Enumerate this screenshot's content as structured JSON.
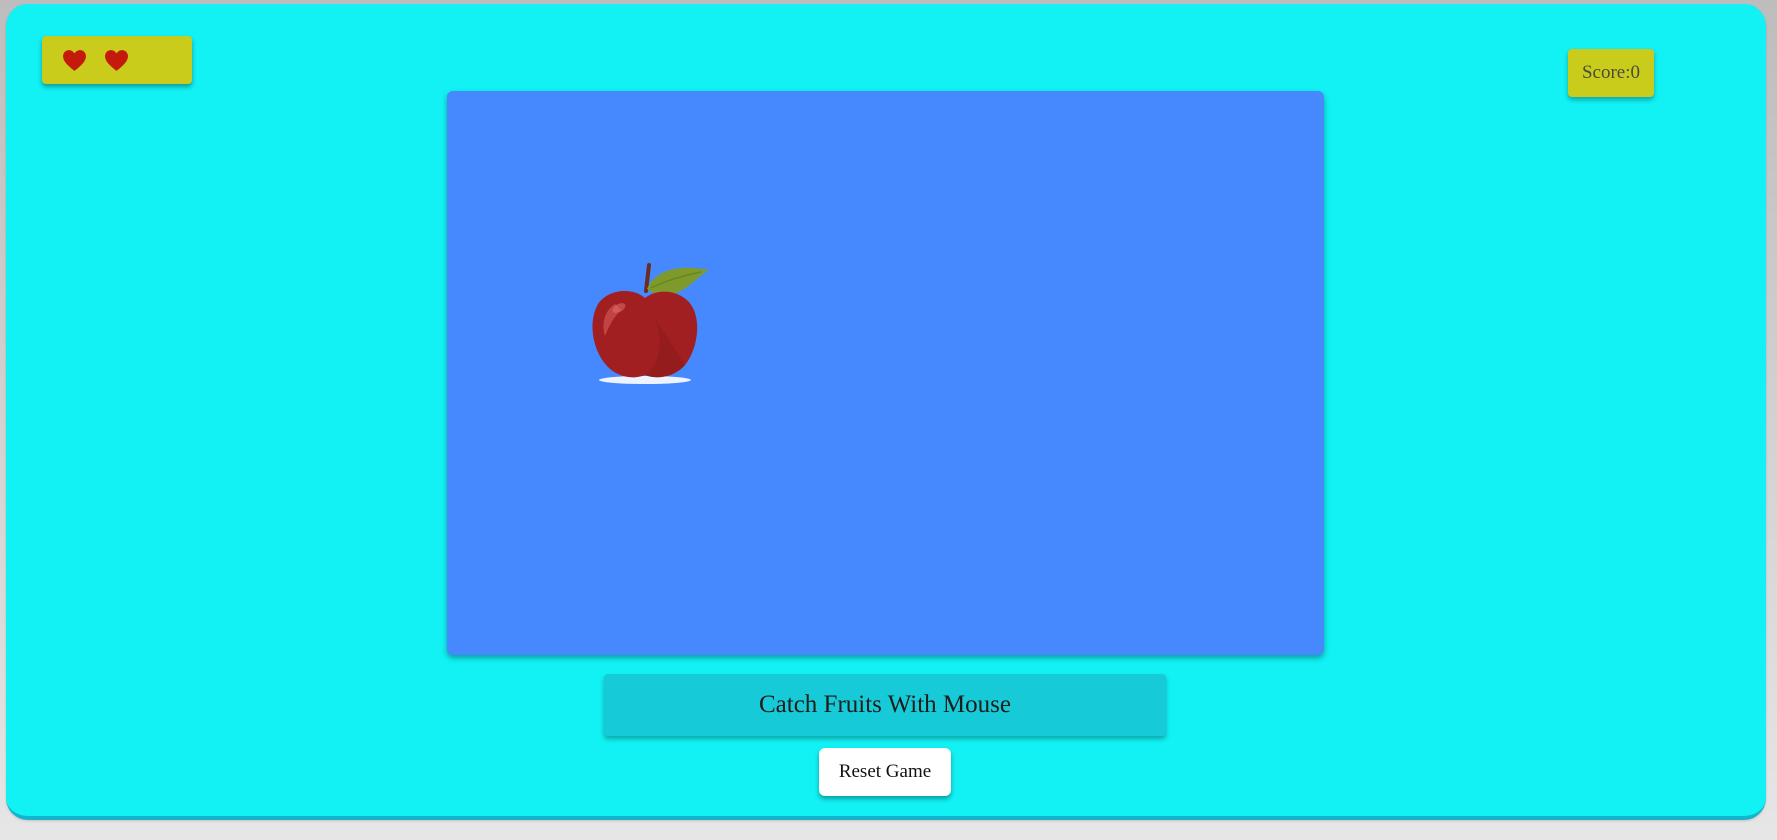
{
  "lives": {
    "count": 2,
    "icon": "heart-icon",
    "color": "#c41a0c"
  },
  "score": {
    "label": "Score:0"
  },
  "game": {
    "fruit_icon": "apple-icon",
    "background": "#4689fe"
  },
  "instruction": {
    "text": "Catch Fruits With Mouse"
  },
  "controls": {
    "reset_label": "Reset Game"
  },
  "colors": {
    "page_background": "#12f1f3",
    "panel_yellow": "#c9cc1b",
    "instruction_background": "#17cad7"
  }
}
